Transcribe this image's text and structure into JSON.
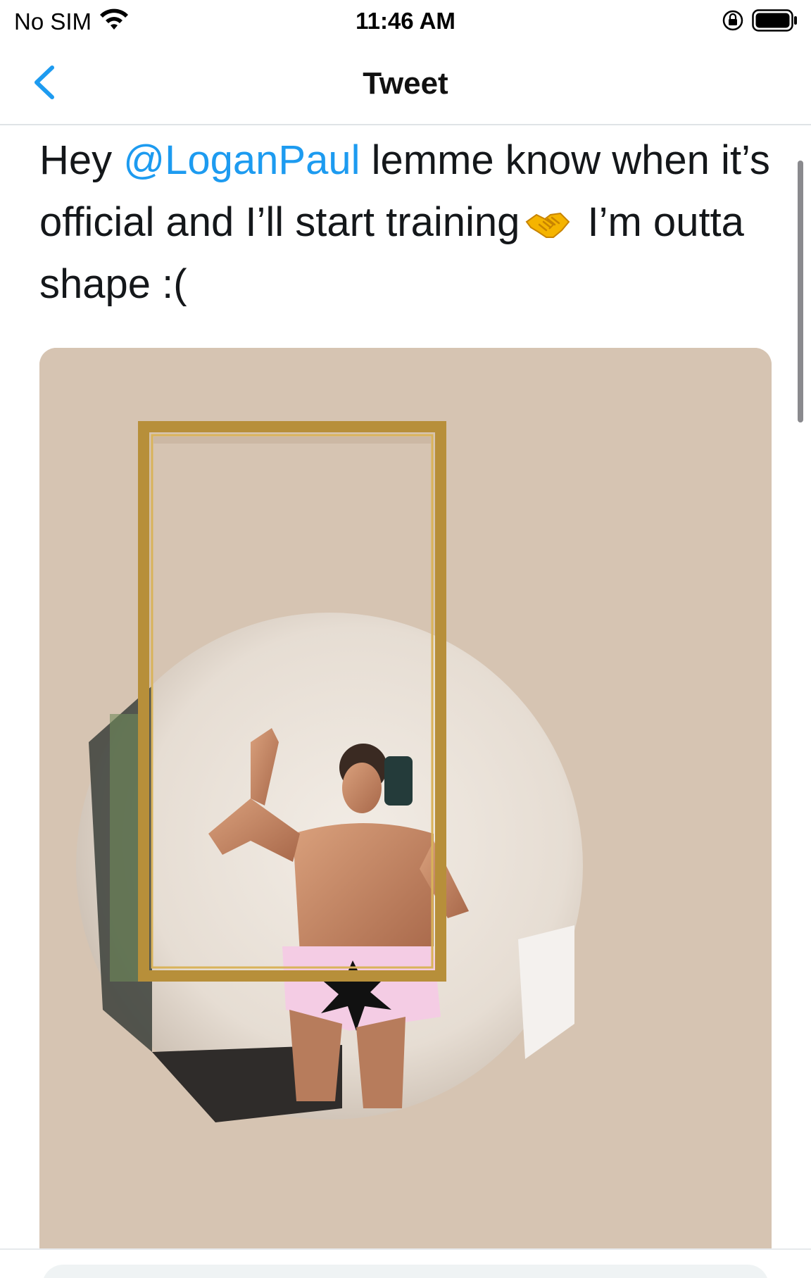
{
  "status_bar": {
    "carrier": "No SIM",
    "time": "11:46 AM",
    "icons": [
      "wifi-icon",
      "orientation-lock-icon",
      "battery-icon"
    ]
  },
  "nav": {
    "title": "Tweet",
    "back_icon": "chevron-left-icon"
  },
  "tweet": {
    "text_before": "Hey ",
    "mention": "@LoganPaul",
    "text_middle": " lemme know when it’s official and I’ll start training",
    "emoji": "handshake-emoji",
    "text_after": " I’m outta shape :("
  },
  "media": {
    "description_icon": "photo"
  },
  "colors": {
    "link": "#1d9bf0",
    "text": "#14171a",
    "divider": "#dfe3e6"
  }
}
